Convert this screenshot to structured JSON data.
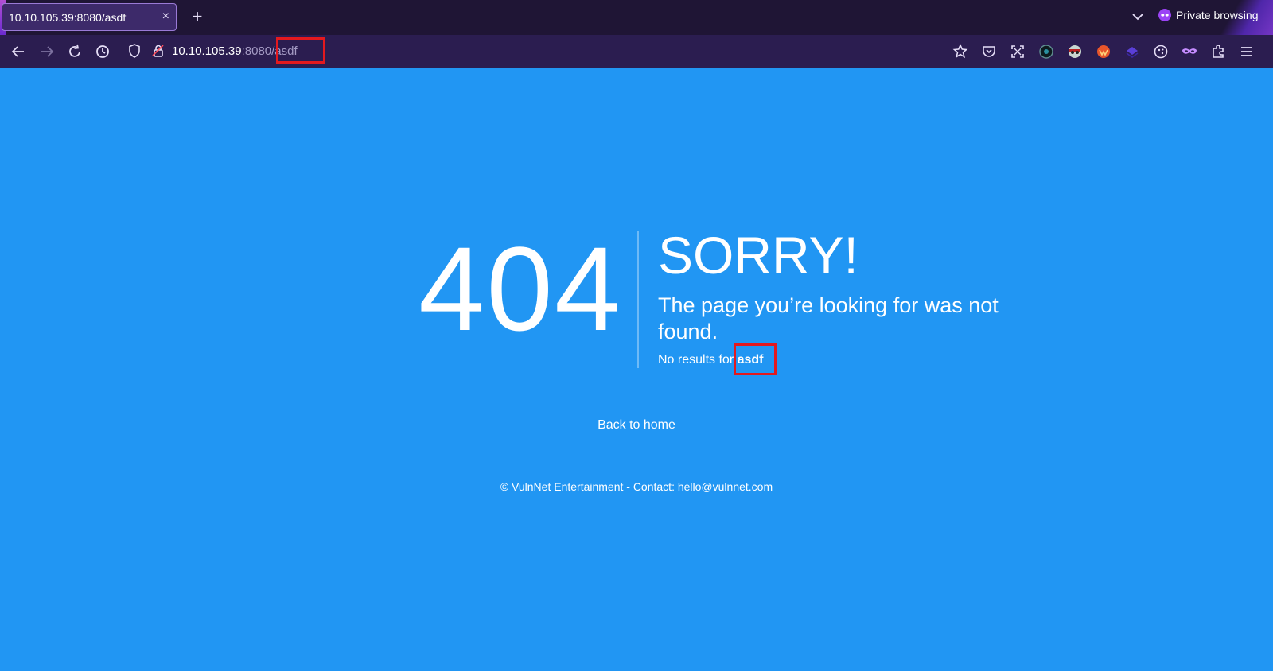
{
  "browser": {
    "tab": {
      "title": "10.10.105.39:8080/asdf",
      "close": "×"
    },
    "new_tab": "+",
    "private_label": "Private browsing",
    "url": {
      "host": "10.10.105.39",
      "port": ":8080",
      "path": "/asdf"
    }
  },
  "page": {
    "code": "404",
    "heading": "SORRY!",
    "message": "The page you’re looking for was not found.",
    "no_results_prefix": "No results for ",
    "query": "asdf",
    "back_link": "Back to home",
    "footer": "© VulnNet Entertainment - Contact: hello@vulnnet.com"
  },
  "colors": {
    "page_background": "#2196f3",
    "browser_chrome": "#2b1d50",
    "tabstrip": "#1f1535",
    "highlight_box": "#e3191e"
  }
}
